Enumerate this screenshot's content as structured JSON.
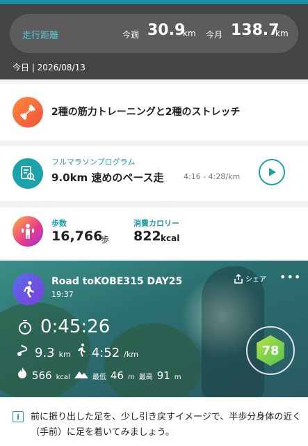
{
  "header": {
    "distance_label": "走行距離",
    "week_label": "今週",
    "week_value": "30.9",
    "week_unit": "km",
    "month_label": "今月",
    "month_value": "138.7",
    "month_unit": "km",
    "date_line": "今日 | 2026/08/13"
  },
  "training_card": {
    "text": "2種の筋力トレーニングと2種のストレッチ"
  },
  "program_card": {
    "label": "フルマラソンプログラム",
    "title": "9.0km 速めのペース走",
    "pace": "4:16 - 4:28/km"
  },
  "activity_card": {
    "steps_label": "歩数",
    "steps_value": "16,766",
    "steps_unit": "歩",
    "calories_label": "消費カロリー",
    "calories_value": "822",
    "calories_unit": "kcal"
  },
  "run_card": {
    "title": "Road toKOBE315 DAY25",
    "time": "19:37",
    "share_label": "シェア",
    "more_label": "•••",
    "duration": "0:45:26",
    "distance_value": "9.3",
    "distance_unit": "km",
    "pace_value": "4:52",
    "pace_unit": "/km",
    "calories_value": "566",
    "calories_unit": "kcal",
    "elev_min_label": "最低",
    "elev_min_value": "46",
    "elev_min_unit": "m",
    "elev_max_label": "最高",
    "elev_max_value": "91",
    "elev_max_unit": "m",
    "score": "78"
  },
  "tip": {
    "text": "前に振り出した足を、少し引き戻すイメージで、半歩分身体の近く（手前）に足を着いてみましょう。"
  },
  "colors": {
    "accent": "#1aa3a8",
    "header_bg": "#444444"
  }
}
